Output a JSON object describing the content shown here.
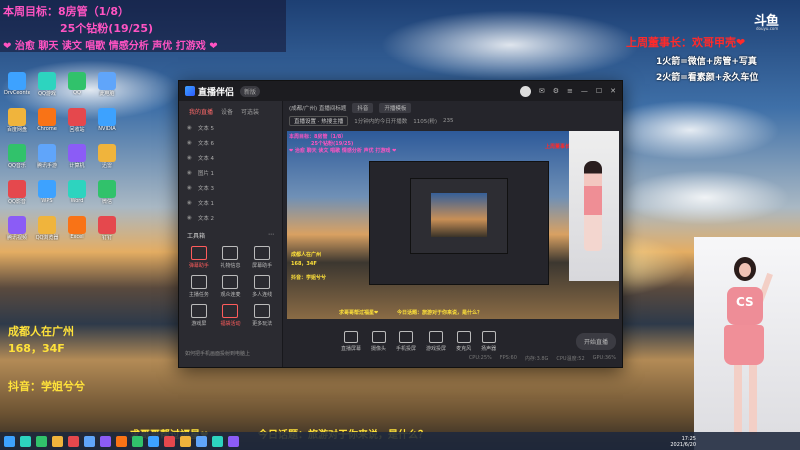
{
  "overlay": {
    "week_goal": "本周目标：8房管（1/8）",
    "diamond_fans": "25个钻粉(19/25)",
    "tags": "❤ 治愈 聊天 读文 唱歌 情感分析 声优 打游戏 ❤",
    "location_line1": "成都人在广州",
    "location_line2": "168，34F",
    "douyin": "抖音：学姐兮兮",
    "boss_title": "上周董事长：欢哥甲壳❤",
    "arrow1": "1火箭=微信+房管+写真",
    "arrow2": "2火箭=看素颜+永久车位",
    "ticker_left": "求哥哥帮过福星❤",
    "ticker_right": "今日话题：旅游对于你来说，是什么？"
  },
  "colors": {
    "pink": "#ff53c2",
    "yellow": "#ffe23a",
    "red": "#ff2a2a",
    "accent_red": "#ff5c5c"
  },
  "app": {
    "name": "直播伴侣",
    "version": "新版",
    "tabs": [
      "我的直播",
      "设备",
      "可选装"
    ],
    "sources": [
      "文本 5",
      "文本 6",
      "文本 4",
      "图片 1",
      "文本 3",
      "文本 1",
      "文本 2"
    ],
    "scene_platform": "(成都/广州) 直播间标题",
    "scene_pill": "抖音",
    "scene_right": "开播模板",
    "sub_left": "直播设置 · 热搜主播",
    "sub_mid": "1分钟内的今日开播数",
    "sub_count": "1105(粉)",
    "sub_value": "235",
    "tool_header": "工具箱",
    "tools": [
      {
        "label": "弹幕助手",
        "icon": "danmaku-icon",
        "active": true
      },
      {
        "label": "礼物信息",
        "icon": "gift-icon",
        "active": false
      },
      {
        "label": "屏幕助手",
        "icon": "screen-icon",
        "active": false
      },
      {
        "label": "主播任务",
        "icon": "task-icon",
        "active": false
      },
      {
        "label": "观众连麦",
        "icon": "link-icon",
        "active": false
      },
      {
        "label": "多人连线",
        "icon": "multi-icon",
        "active": false
      },
      {
        "label": "游戏屏",
        "icon": "game-icon",
        "active": false
      },
      {
        "label": "福袋活动",
        "icon": "lucky-bag-icon",
        "active": true
      },
      {
        "label": "更多玩法",
        "icon": "more-icon",
        "active": false
      }
    ],
    "left_bottom": "如何把手机画面投射到电脑上",
    "controls": [
      "直播屏幕",
      "摄像头",
      "手机投屏",
      "游戏投屏",
      "麦克风",
      "扬声器"
    ],
    "start_button": "开始直播",
    "status": [
      "CPU:25%",
      "FPS:60",
      "内存:3.8G",
      "CPU温度:52",
      "GPU:36%"
    ]
  },
  "desktop_icons": [
    "DrvCeonter",
    "百度网盘",
    "QQ音乐",
    "QQ影音",
    "腾讯视频",
    "QQ游戏",
    "Chrome",
    "腾讯手游",
    "WPS",
    "QQ浏览器",
    "QQ",
    "回收站",
    "计算机",
    "Word",
    "Excel",
    "此电脑",
    "NVIDIA",
    "迅雷",
    "微信",
    "钉钉"
  ],
  "taskbar": {
    "clock_time": "17:25",
    "clock_date": "2021/6/20"
  },
  "brand_logo": "斗鱼",
  "brand_logo_sub": "douyu.com"
}
